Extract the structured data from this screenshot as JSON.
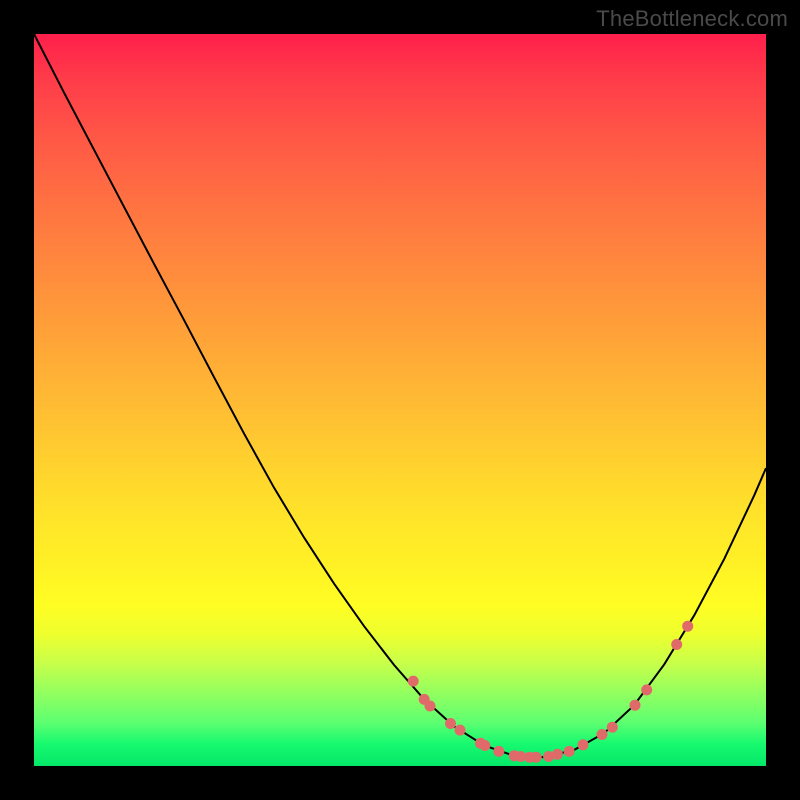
{
  "watermark": "TheBottleneck.com",
  "chart_data": {
    "type": "line",
    "title": "",
    "xlabel": "",
    "ylabel": "",
    "xlim": [
      0,
      100
    ],
    "ylim": [
      0,
      100
    ],
    "grid": false,
    "legend": false,
    "colors": {
      "curve": "#000000",
      "markers": "#e06a6a",
      "gradient_top": "#ff1f4b",
      "gradient_bottom": "#05e768"
    },
    "curve_points": [
      {
        "x": 0.0,
        "y": 100.0
      },
      {
        "x": 4.1,
        "y": 92.0
      },
      {
        "x": 8.2,
        "y": 84.2
      },
      {
        "x": 12.3,
        "y": 76.4
      },
      {
        "x": 16.4,
        "y": 68.6
      },
      {
        "x": 20.5,
        "y": 60.9
      },
      {
        "x": 24.6,
        "y": 53.1
      },
      {
        "x": 28.7,
        "y": 45.4
      },
      {
        "x": 32.8,
        "y": 38.0
      },
      {
        "x": 36.9,
        "y": 31.2
      },
      {
        "x": 41.0,
        "y": 24.9
      },
      {
        "x": 45.1,
        "y": 19.1
      },
      {
        "x": 49.2,
        "y": 13.8
      },
      {
        "x": 53.3,
        "y": 9.1
      },
      {
        "x": 57.4,
        "y": 5.4
      },
      {
        "x": 61.5,
        "y": 2.8
      },
      {
        "x": 65.6,
        "y": 1.4
      },
      {
        "x": 69.7,
        "y": 1.2
      },
      {
        "x": 73.8,
        "y": 2.2
      },
      {
        "x": 77.9,
        "y": 4.5
      },
      {
        "x": 82.0,
        "y": 8.3
      },
      {
        "x": 86.1,
        "y": 13.9
      },
      {
        "x": 90.2,
        "y": 20.6
      },
      {
        "x": 94.3,
        "y": 28.3
      },
      {
        "x": 98.4,
        "y": 37.0
      },
      {
        "x": 100.0,
        "y": 40.7
      }
    ],
    "markers_on_curve": [
      {
        "x": 51.8,
        "y": 11.6
      },
      {
        "x": 53.3,
        "y": 9.1
      },
      {
        "x": 54.1,
        "y": 8.2
      },
      {
        "x": 56.9,
        "y": 5.8
      },
      {
        "x": 58.2,
        "y": 4.9
      },
      {
        "x": 61.0,
        "y": 3.1
      },
      {
        "x": 61.6,
        "y": 2.8
      },
      {
        "x": 63.5,
        "y": 2.0
      },
      {
        "x": 65.6,
        "y": 1.4
      },
      {
        "x": 66.5,
        "y": 1.3
      },
      {
        "x": 67.7,
        "y": 1.2
      },
      {
        "x": 68.6,
        "y": 1.2
      },
      {
        "x": 70.3,
        "y": 1.3
      },
      {
        "x": 71.5,
        "y": 1.6
      },
      {
        "x": 73.1,
        "y": 2.0
      },
      {
        "x": 75.0,
        "y": 2.9
      },
      {
        "x": 77.6,
        "y": 4.3
      },
      {
        "x": 79.0,
        "y": 5.3
      },
      {
        "x": 82.1,
        "y": 8.3
      },
      {
        "x": 83.7,
        "y": 10.4
      },
      {
        "x": 87.8,
        "y": 16.6
      },
      {
        "x": 89.3,
        "y": 19.1
      }
    ],
    "annotations": []
  }
}
